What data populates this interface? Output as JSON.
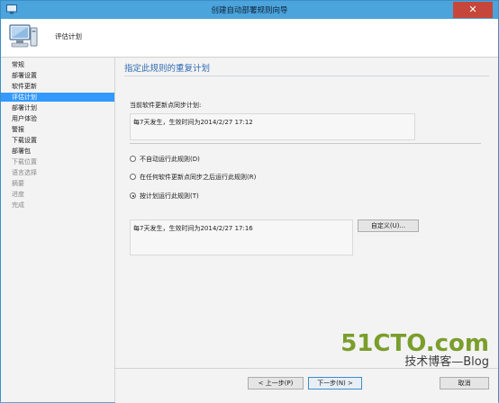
{
  "window": {
    "title": "创建自动部署规则向导",
    "close_label": "✕"
  },
  "header": {
    "title": "评估计划",
    "icon": "computer-wizard-icon"
  },
  "sidebar": {
    "items": [
      {
        "label": "常规",
        "state": "normal"
      },
      {
        "label": "部署设置",
        "state": "normal"
      },
      {
        "label": "软件更新",
        "state": "normal"
      },
      {
        "label": "评估计划",
        "state": "active"
      },
      {
        "label": "部署计划",
        "state": "normal"
      },
      {
        "label": "用户体验",
        "state": "normal"
      },
      {
        "label": "警报",
        "state": "normal"
      },
      {
        "label": "下载设置",
        "state": "normal"
      },
      {
        "label": "部署包",
        "state": "normal"
      },
      {
        "label": "下载位置",
        "state": "disabled"
      },
      {
        "label": "语言选择",
        "state": "disabled"
      },
      {
        "label": "摘要",
        "state": "disabled"
      },
      {
        "label": "进度",
        "state": "disabled"
      },
      {
        "label": "完成",
        "state": "disabled"
      }
    ]
  },
  "main": {
    "title": "指定此规则的重复计划",
    "current_schedule_label": "当前软件更新点同步计划:",
    "current_schedule_value": "每7天发生，生效时间为2014/2/27 17:12",
    "options": [
      {
        "label": "不自动运行此规则(D)",
        "checked": false
      },
      {
        "label": "在任何软件更新点同步之后运行此规则(R)",
        "checked": false
      },
      {
        "label": "按计划运行此规则(T)",
        "checked": true
      }
    ],
    "schedule_value": "每7天发生，生效时间为2014/2/27 17:16",
    "customize_button": "自定义(U)..."
  },
  "footer": {
    "prev_button": "< 上一步(P)",
    "next_button": "下一步(N) >",
    "cancel_button": "取消"
  },
  "watermark": {
    "big": "51CTO.com",
    "sub": "技术博客—Blog"
  },
  "colors": {
    "active": "#3399ff",
    "title_blue": "#2f6ab3",
    "titlebar": "#4ba4dc",
    "close": "#c7463b"
  }
}
